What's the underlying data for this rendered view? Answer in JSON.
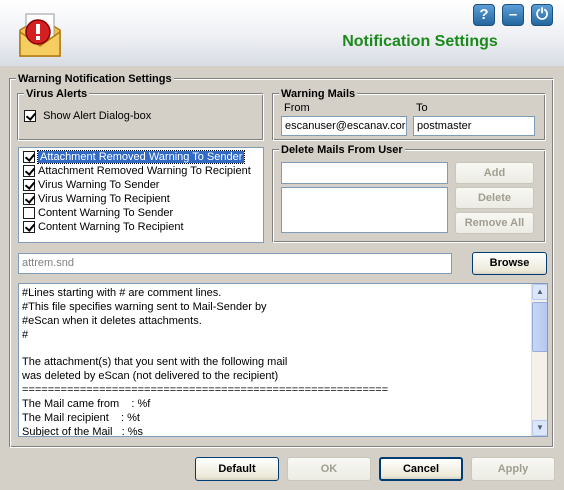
{
  "header": {
    "title": "Notification Settings",
    "help_glyph": "?",
    "minimize_glyph": "–",
    "power_glyph": "⏻",
    "title_color": "#1b8a1b"
  },
  "warning_notification": {
    "label": "Warning Notification Settings",
    "virus_alerts": {
      "label": "Virus Alerts",
      "show_alert": {
        "label": "Show Alert Dialog-box",
        "checked": true
      }
    },
    "warning_options": [
      {
        "label": "Attachment Removed Warning To Sender",
        "checked": true,
        "selected": true
      },
      {
        "label": "Attachment Removed Warning To Recipient",
        "checked": true,
        "selected": false
      },
      {
        "label": "Virus Warning To Sender",
        "checked": true,
        "selected": false
      },
      {
        "label": "Virus Warning To Recipient",
        "checked": true,
        "selected": false
      },
      {
        "label": "Content Warning To Sender",
        "checked": false,
        "selected": false
      },
      {
        "label": "Content Warning To Recipient",
        "checked": true,
        "selected": false
      }
    ],
    "warning_mails": {
      "label": "Warning Mails",
      "from_label": "From",
      "to_label": "To",
      "from_value": "escanuser@escanav.cor",
      "to_value": "postmaster"
    },
    "delete_mails": {
      "label": "Delete Mails From User",
      "add_label": "Add",
      "delete_label": "Delete",
      "remove_all_label": "Remove All",
      "input_value": "",
      "list": []
    },
    "template_file": "attrem.snd",
    "browse_label": "Browse",
    "template_lines": [
      "#Lines starting with # are comment lines.",
      "#This file specifies warning sent to Mail-Sender by",
      "#eScan when it deletes attachments.",
      "#",
      "",
      "The attachment(s) that you sent with the following mail",
      "was deleted by eScan (not delivered to the recipient)",
      "=========================================================",
      "The Mail came from    : %f",
      "The Mail recipient    : %t",
      "Subject of the Mail   : %s"
    ]
  },
  "footer": {
    "default_label": "Default",
    "ok_label": "OK",
    "cancel_label": "Cancel",
    "apply_label": "Apply"
  }
}
